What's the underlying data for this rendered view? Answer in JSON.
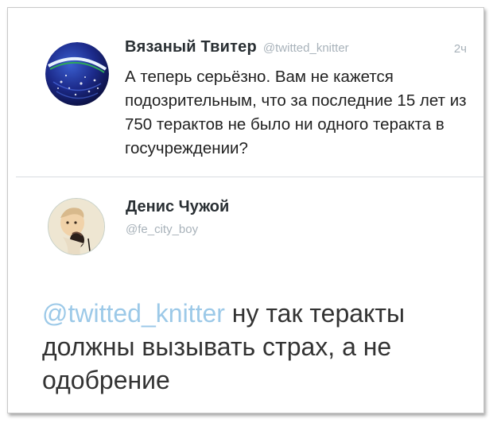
{
  "tweet1": {
    "name": "Вязаный Твитер",
    "handle": "@twitted_knitter",
    "time": "2ч",
    "text": "А теперь серьёзно. Вам не кажется подозрительным, что за последние 15 лет из 750 терактов не было ни одного теракта в госучреждении?",
    "avatar_icon": "knitted-ball-globe-icon"
  },
  "tweet2": {
    "name": "Денис Чужой",
    "handle": "@fe_city_boy",
    "mention": "@twitted_knitter",
    "text": " ну так теракты должны вызывать страх, а не одобрение",
    "avatar_icon": "child-portrait-icon"
  },
  "colors": {
    "mention": "#9cc9e8",
    "handle": "#a8b2ba",
    "name": "#292f33",
    "divider": "#d8dde1"
  }
}
